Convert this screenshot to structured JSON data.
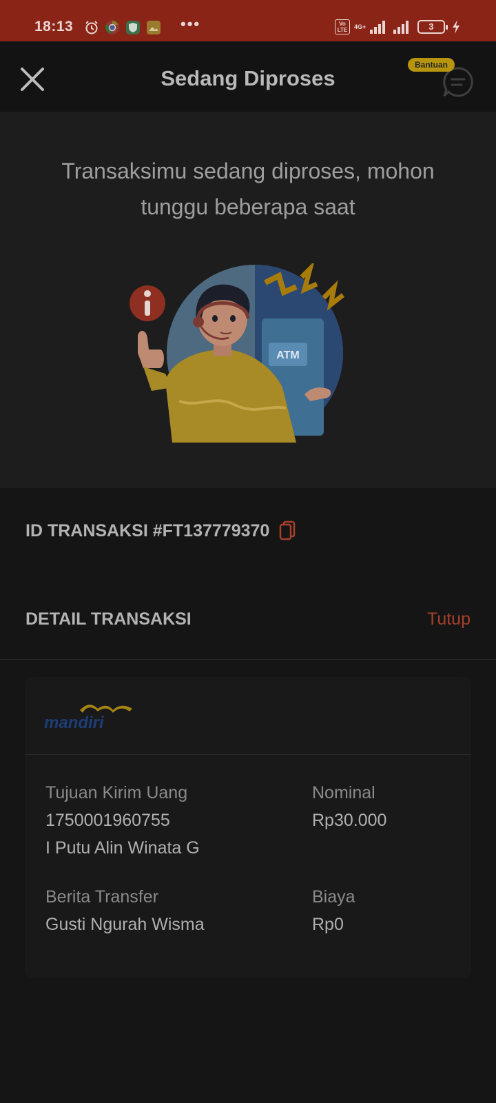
{
  "status_bar": {
    "time": "18:13",
    "dots": "•••",
    "volte": "Vo LTE",
    "network": "4G+",
    "battery": "3",
    "icons": [
      "alarm-icon",
      "chrome-icon",
      "shield-app-icon",
      "gallery-app-icon",
      "signal-icon",
      "charging-icon"
    ]
  },
  "header": {
    "title": "Sedang Diproses",
    "help_badge": "Bantuan"
  },
  "hero": {
    "message": "Transaksimu sedang diproses, mohon tunggu beberapa saat",
    "illustration_atm_label": "ATM"
  },
  "transaction": {
    "id_label": "ID TRANSAKSI #FT137779370"
  },
  "detail": {
    "title": "DETAIL TRANSAKSI",
    "toggle_label": "Tutup",
    "bank_name": "mandiri",
    "recipient_label": "Tujuan Kirim Uang",
    "account_number": "1750001960755",
    "recipient_name": "I Putu Alin Winata G",
    "nominal_label": "Nominal",
    "nominal_value": "Rp30.000",
    "message_label": "Berita Transfer",
    "message_value": "Gusti Ngurah Wisma",
    "fee_label": "Biaya",
    "fee_value": "Rp0"
  },
  "colors": {
    "status_bar": "#8a2417",
    "accent": "#a6402c",
    "badge": "#b8950e",
    "background": "#151515"
  }
}
